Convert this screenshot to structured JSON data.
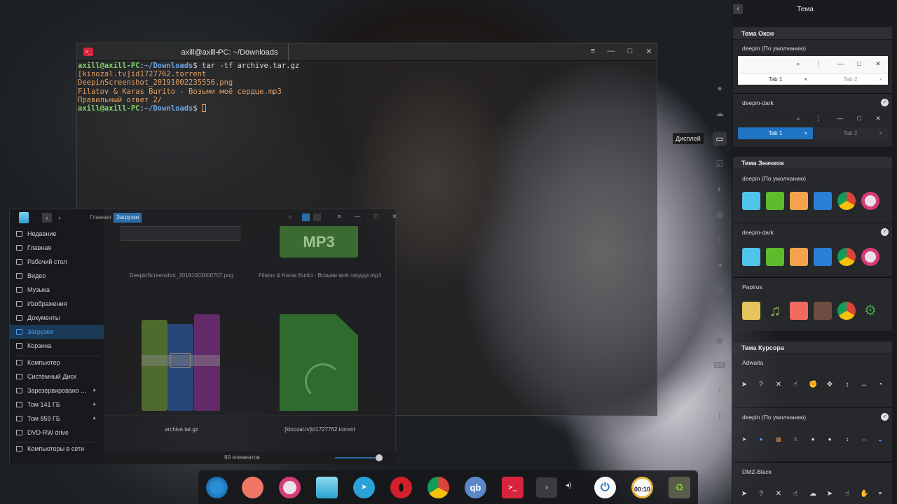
{
  "terminal": {
    "tab_title": "axill@axill-PC: ~/Downloads",
    "add_tab": "+",
    "menu_icon": "≡",
    "minimize": "—",
    "maximize": "□",
    "close": "✕",
    "line1_user": "axill@axill-PC",
    "line1_sep": ":",
    "line1_path": "~/Downloads",
    "line1_cmd": "$ tar -tf archive.tar.gz",
    "out1": "[kinozal.tv]id1727762.torrent",
    "out2": "DeepinScreenshot_20191002235556.png",
    "out3": "Filatov & Karas Burito - Возьми моё сердце.mp3",
    "out4": "Правильный ответ 2/",
    "prompt_user": "axill@axill-PC",
    "prompt_sep": ":",
    "prompt_path": "~/Downloads",
    "prompt_end": "$ "
  },
  "filemanager": {
    "back": "‹",
    "forward": "›",
    "crumbs": [
      "Главная",
      "Загрузки"
    ],
    "sidebar": [
      "Недавние",
      "Главная",
      "Рабочий стол",
      "Видео",
      "Музыка",
      "Изображения",
      "Документы",
      "Загрузки",
      "Корзина"
    ],
    "devices": [
      "Компьютер",
      "Системный Диск",
      "Зарезервировано ...",
      "Том 141 ГБ",
      "Том 859 ГБ",
      "DVD-RW drive"
    ],
    "network": "Компьютеры в сети",
    "files": [
      "DeepinScreenshot_20191003000707.png",
      "Filatov & Karas Burito - Возьми моё сердце.mp3",
      "archive.tar.gz",
      "[kinozal.tv]id1727762.torrent"
    ],
    "mp3_label": "MP3",
    "status": "90 элементов",
    "eject": "▲",
    "zoom_level": 0.85
  },
  "control_center": {
    "back": "‹",
    "title": "Тема",
    "tooltip": "Дисплей",
    "window_theme_header": "Тема Окон",
    "window_themes": [
      {
        "name": "deepin (По умолчанию)",
        "selected": false
      },
      {
        "name": "deepin-dark",
        "selected": true
      }
    ],
    "tab1": "Tab 1",
    "tab2": "Tab 2",
    "tab_close": "×",
    "search_icon": "⌕",
    "more_icon": "⋮",
    "min_icon": "—",
    "max_icon": "□",
    "close_icon": "✕",
    "check": "✓",
    "icon_theme_header": "Тема Значков",
    "icon_themes": [
      {
        "name": "deepin (По умолчанию)",
        "selected": false
      },
      {
        "name": "deepin-dark",
        "selected": true
      },
      {
        "name": "Papirus",
        "selected": false
      }
    ],
    "cursor_theme_header": "Тема Курсора",
    "cursor_themes": [
      {
        "name": "Adwaita",
        "selected": false
      },
      {
        "name": "deepin (По умолчанию)",
        "selected": true
      },
      {
        "name": "DMZ-Black",
        "selected": false
      }
    ]
  },
  "dock": {
    "qb_label": "qb",
    "term_label": ">_",
    "arrow": "›",
    "volume": "◂)",
    "clock_label": "00:10"
  },
  "colors": {
    "accent": "#2e6ca6",
    "tab_active": "#1f74c4",
    "terminal_text": "#e2a064",
    "prompt_user": "#7fd36b",
    "prompt_path": "#6ea6df"
  }
}
